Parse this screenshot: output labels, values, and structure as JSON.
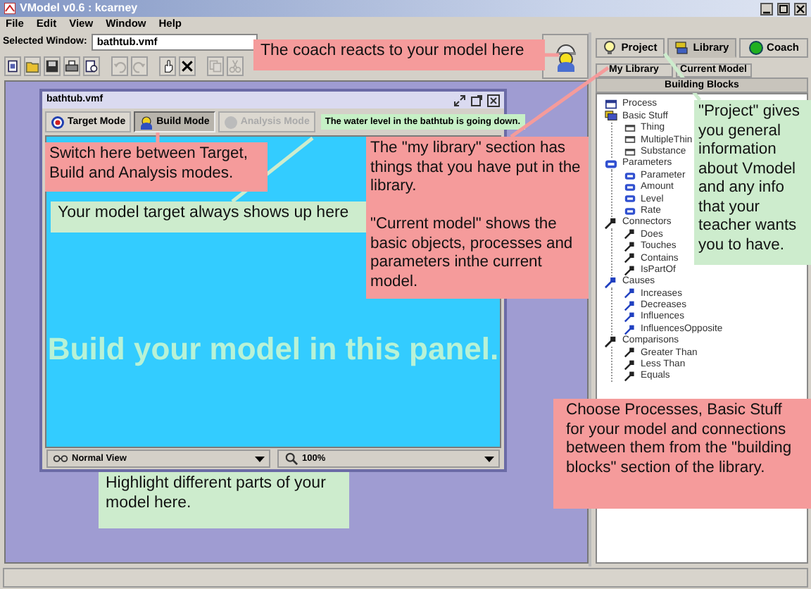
{
  "window": {
    "title": "VModel v0.6 : kcarney"
  },
  "menu": [
    "File",
    "Edit",
    "View",
    "Window",
    "Help"
  ],
  "selected_window": {
    "label": "Selected Window:",
    "value": "bathtub.vmf"
  },
  "toolbar": [
    {
      "kind": "new",
      "disabled": false
    },
    {
      "kind": "open",
      "disabled": false
    },
    {
      "kind": "save",
      "disabled": false
    },
    {
      "kind": "print",
      "disabled": false
    },
    {
      "kind": "preview",
      "disabled": false
    },
    {
      "kind": "undo",
      "disabled": true
    },
    {
      "kind": "redo",
      "disabled": true
    },
    {
      "kind": "hand",
      "disabled": false
    },
    {
      "kind": "delete",
      "disabled": false
    },
    {
      "kind": "copy",
      "disabled": true
    },
    {
      "kind": "cut",
      "disabled": true
    }
  ],
  "library_tabs": [
    {
      "label": "Project",
      "kind": "project",
      "selected": false
    },
    {
      "label": "Library",
      "kind": "library",
      "selected": true
    },
    {
      "label": "Coach",
      "kind": "coach",
      "selected": false
    }
  ],
  "library_subtabs": [
    {
      "label": "My Library",
      "selected": false
    },
    {
      "label": "Current Model",
      "selected": false
    },
    {
      "label": "Building Blocks",
      "selected": true
    }
  ],
  "tree": [
    {
      "label": "Process",
      "kind": "object"
    },
    {
      "label": "Basic Stuff",
      "kind": "basic",
      "children": [
        {
          "label": "Thing"
        },
        {
          "label": "MultipleThin"
        },
        {
          "label": "Substance"
        }
      ]
    },
    {
      "label": "Parameters",
      "kind": "parameter",
      "children": [
        {
          "label": "Parameter"
        },
        {
          "label": "Amount"
        },
        {
          "label": "Level"
        },
        {
          "label": "Rate"
        }
      ]
    },
    {
      "label": "Connectors",
      "kind": "connector",
      "children": [
        {
          "label": "Does"
        },
        {
          "label": "Touches"
        },
        {
          "label": "Contains"
        },
        {
          "label": "IsPartOf"
        }
      ]
    },
    {
      "label": "Causes",
      "kind": "cause",
      "children": [
        {
          "label": "Increases"
        },
        {
          "label": "Decreases"
        },
        {
          "label": "Influences"
        },
        {
          "label": "InfluencesOpposite"
        }
      ]
    },
    {
      "label": "Comparisons",
      "kind": "connector",
      "children": [
        {
          "label": "Greater Than"
        },
        {
          "label": "Less Than"
        },
        {
          "label": "Equals"
        }
      ]
    }
  ],
  "model_window": {
    "title": "bathtub.vmf",
    "modes": [
      {
        "label": "Target Mode",
        "kind": "target",
        "selected": false,
        "disabled": false
      },
      {
        "label": "Build Mode",
        "kind": "build",
        "selected": true,
        "disabled": false
      },
      {
        "label": "Analysis Mode",
        "kind": "analysis",
        "selected": false,
        "disabled": true
      }
    ],
    "target": "The water level in the bathtub is going down.",
    "canvas_hint": "Build your model in this panel.",
    "view_selectors": [
      {
        "kind": "view",
        "value": "Normal View"
      },
      {
        "kind": "zoom",
        "value": "100%"
      }
    ]
  },
  "callouts": [
    {
      "color": "#f59b9b",
      "paragraphs": [
        "The coach reacts to your model here"
      ]
    },
    {
      "color": "#f59b9b",
      "paragraphs": [
        "Switch here between Target, Build and Analysis modes."
      ]
    },
    {
      "color": "#cdeccd",
      "paragraphs": [
        "Your model target always shows up here"
      ]
    },
    {
      "color": "#f59b9b",
      "paragraphs": [
        "The \"my library\" section has things that you have put in the library.",
        "\"Current model\" shows the basic objects, processes and parameters  inthe current model."
      ]
    },
    {
      "color": "#cdeccd",
      "paragraphs": [
        "\"Project\" gives you general information about Vmodel and any info that your teacher wants you to have."
      ]
    },
    {
      "color": "#f59b9b",
      "paragraphs": [
        "Choose Processes, Basic Stuff for your model and connections between them from the \"building blocks\" section of  the library."
      ]
    },
    {
      "color": "#cdeccd",
      "paragraphs": [
        "Highlight different parts of your model here."
      ]
    }
  ]
}
